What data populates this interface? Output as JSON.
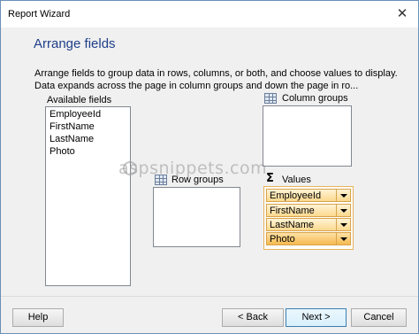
{
  "window": {
    "title": "Report Wizard",
    "close_glyph": "✕"
  },
  "header": {
    "title": "Arrange fields"
  },
  "description": "Arrange fields to group data in rows, columns, or both, and choose values to display. Data expands across the page in column groups and down the page in ro...",
  "available_fields": {
    "label": "Available fields",
    "items": [
      "EmployeeId",
      "FirstName",
      "LastName",
      "Photo"
    ]
  },
  "column_groups": {
    "label": "Column groups",
    "icon": "grid-icon"
  },
  "row_groups": {
    "label": "Row groups",
    "icon": "grid-icon"
  },
  "values": {
    "label": "Values",
    "icon": "sigma-icon",
    "items": [
      "EmployeeId",
      "FirstName",
      "LastName",
      "Photo"
    ],
    "selected_index": 3
  },
  "watermark": "aspsnippets.com",
  "buttons": {
    "help": "Help",
    "back": "< Back",
    "next": "Next >",
    "cancel": "Cancel"
  },
  "colors": {
    "header_title": "#1f3f8a",
    "values_border": "#e8b25a",
    "values_item": "#fcd98e"
  }
}
